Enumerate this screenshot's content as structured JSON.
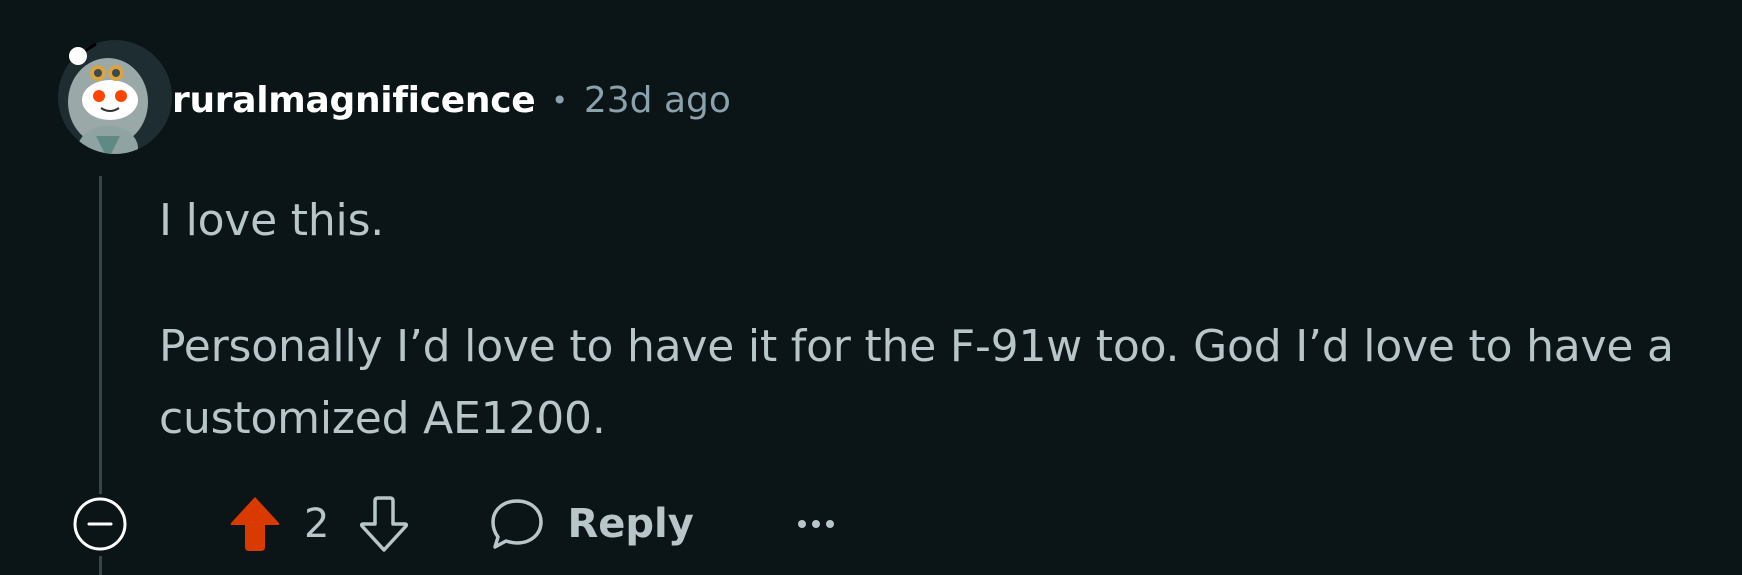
{
  "comment": {
    "author": "ruralmagnificence",
    "separator": "•",
    "time_ago": "23d ago",
    "paragraphs": [
      "I love this.",
      "Personally I’d love to have it for the F-91w too. God I’d love to have a customized AE1200."
    ],
    "score": "2",
    "reply_label": "Reply",
    "vote_state": "upvoted"
  },
  "icons": {
    "avatar": "snoo-avatar",
    "collapse": "collapse-minus-icon",
    "upvote": "upvote-arrow-icon",
    "downvote": "downvote-arrow-icon",
    "reply": "speech-bubble-icon",
    "more": "more-dots-icon"
  },
  "colors": {
    "background": "#0b1416",
    "username": "#ffffff",
    "meta": "#8ba2ad",
    "body_text": "#b8c5c9",
    "upvote_active": "#d93a00",
    "thread_line": "#33464c"
  }
}
